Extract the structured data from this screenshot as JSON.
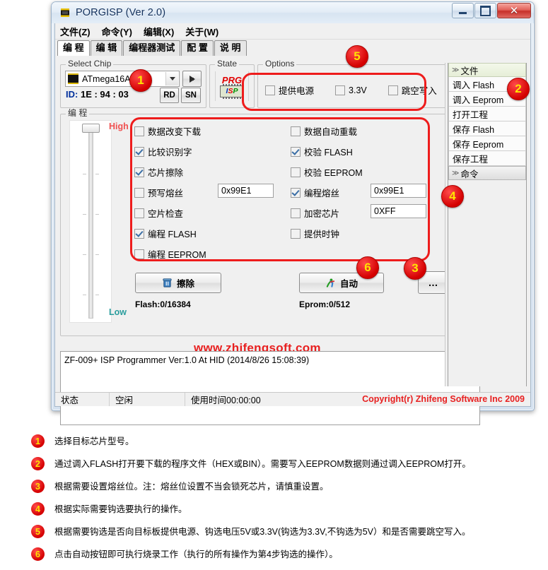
{
  "window": {
    "title": "PORGISP (Ver 2.0)",
    "icon": "chip-icon",
    "minimize": "minimize-icon",
    "maximize": "maximize-icon",
    "close": "close-icon"
  },
  "menu": [
    "文件(Z)",
    "命令(Y)",
    "编辑(X)",
    "关于(W)"
  ],
  "tabs": [
    {
      "label": "编 程",
      "active": true
    },
    {
      "label": "编 辑",
      "active": false
    },
    {
      "label": "编程器测试",
      "active": false
    },
    {
      "label": "配 置",
      "active": false
    },
    {
      "label": "说 明",
      "active": false
    }
  ],
  "select_chip": {
    "group_title": "Select Chip",
    "chip_value": "ATmega16A",
    "go_button": "arrow-right-icon",
    "id_label": "ID:",
    "id_value": "1E : 94 : 03",
    "rd_button": "RD",
    "sn_button": "SN"
  },
  "state": {
    "group_title": "State",
    "prg": "PRG",
    "isp_i": "I",
    "isp_s": "S",
    "isp_p": "P"
  },
  "options": {
    "group_title": "Options",
    "items": [
      {
        "label": "提供电源",
        "checked": false
      },
      {
        "label": "3.3V",
        "checked": false
      },
      {
        "label": "跳空写入",
        "checked": false
      }
    ]
  },
  "program": {
    "group_title": "编 程",
    "slider_high": "High",
    "slider_low": "Low",
    "left_checks": [
      {
        "label": "数据改变下载",
        "checked": false
      },
      {
        "label": "比较识别字",
        "checked": true
      },
      {
        "label": "芯片擦除",
        "checked": true
      },
      {
        "label": "预写熔丝",
        "checked": false
      },
      {
        "label": "空片检查",
        "checked": false
      },
      {
        "label": "编程 FLASH",
        "checked": true
      },
      {
        "label": "编程 EEPROM",
        "checked": false
      }
    ],
    "right_checks": [
      {
        "label": "数据自动重载",
        "checked": false
      },
      {
        "label": "校验 FLASH",
        "checked": true
      },
      {
        "label": "校验 EEPROM",
        "checked": false
      },
      {
        "label": "编程熔丝",
        "checked": true
      },
      {
        "label": "加密芯片",
        "checked": false
      },
      {
        "label": "提供时钟",
        "checked": false
      }
    ],
    "fuse_pre_value": "0x99E1",
    "fuse_prog_value": "0x99E1",
    "lock_value": "0XFF",
    "erase_button": "擦除",
    "erase_icon": "trash-icon",
    "auto_button": "自动",
    "auto_icon": "runner-icon",
    "more_button": "…",
    "flash_status": "Flash:0/16384",
    "eprom_status": "Eprom:0/512"
  },
  "watermark": "www.zhifengsoft.com",
  "log": "ZF-009+ ISP Programmer Ver:1.0 At HID (2014/8/26 15:08:39)",
  "dock": {
    "file_header": "文件",
    "file_items": [
      "调入 Flash",
      "调入 Eeprom",
      "打开工程",
      "保存 Flash",
      "保存 Eeprom",
      "保存工程"
    ],
    "cmd_header": "命令"
  },
  "statusbar": {
    "label": "状态",
    "value": "空闲",
    "time": "使用时间00:00:00",
    "copyright": "Copyright(r) Zhifeng Software Inc 2009"
  },
  "callouts": {
    "b1": "1",
    "b2": "2",
    "b3": "3",
    "b4": "4",
    "b5": "5",
    "b6": "6"
  },
  "legend": [
    {
      "num": "1",
      "text": "选择目标芯片型号。"
    },
    {
      "num": "2",
      "text": "通过调入FLASH打开要下载的程序文件（HEX或BIN）。需要写入EEPROM数据则通过调入EEPROM打开。"
    },
    {
      "num": "3",
      "text": "根据需要设置熔丝位。注：熔丝位设置不当会锁死芯片，请慎重设置。"
    },
    {
      "num": "4",
      "text": "根据实际需要钩选要执行的操作。"
    },
    {
      "num": "5",
      "text": "根据需要钩选是否向目标板提供电源、钩选电压5V或3.3V(钩选为3.3V,不钩选为5V）和是否需要跳空写入。"
    },
    {
      "num": "6",
      "text": "点击自动按钮即可执行烧录工作（执行的所有操作为第4步钩选的操作）。"
    }
  ]
}
